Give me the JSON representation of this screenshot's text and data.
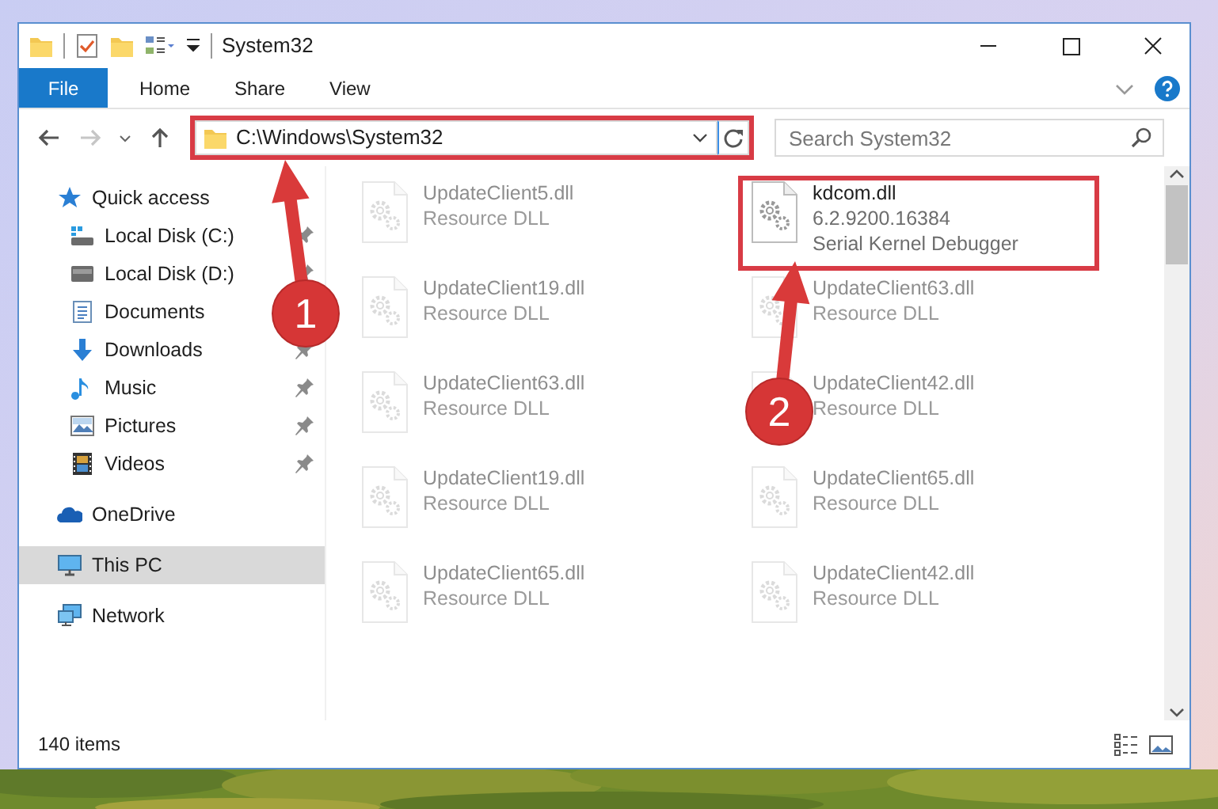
{
  "window": {
    "title": "System32"
  },
  "ribbon_tabs": [
    {
      "label": "File",
      "kind": "file"
    },
    {
      "label": "Home",
      "kind": "tab"
    },
    {
      "label": "Share",
      "kind": "tab"
    },
    {
      "label": "View",
      "kind": "tab"
    }
  ],
  "address": {
    "path": "C:\\Windows\\System32",
    "highlighted": true
  },
  "search": {
    "placeholder": "Search System32"
  },
  "navigation": {
    "forward_disabled": true
  },
  "sidebar": {
    "items": [
      {
        "label": "Quick access",
        "kind": "quick-access",
        "selected": false,
        "children": [
          {
            "label": "Local Disk (C:)",
            "kind": "drive-c",
            "pinned": true
          },
          {
            "label": "Local Disk (D:)",
            "kind": "drive",
            "pinned": true
          },
          {
            "label": "Documents",
            "kind": "documents",
            "pinned": false
          },
          {
            "label": "Downloads",
            "kind": "downloads",
            "pinned": true
          },
          {
            "label": "Music",
            "kind": "music",
            "pinned": true
          },
          {
            "label": "Pictures",
            "kind": "pictures",
            "pinned": true
          },
          {
            "label": "Videos",
            "kind": "videos",
            "pinned": true
          }
        ]
      },
      {
        "label": "OneDrive",
        "kind": "onedrive",
        "selected": false
      },
      {
        "label": "This PC",
        "kind": "this-pc",
        "selected": true
      },
      {
        "label": "Network",
        "kind": "network",
        "selected": false
      }
    ]
  },
  "files": [
    {
      "name": "UpdateClient5.dll",
      "details": [
        "Resource DLL"
      ],
      "faded": true,
      "highlighted": false
    },
    {
      "name": "kdcom.dll",
      "details": [
        "6.2.9200.16384",
        "Serial Kernel Debugger"
      ],
      "faded": false,
      "highlighted": true
    },
    {
      "name": "UpdateClient19.dll",
      "details": [
        "Resource DLL"
      ],
      "faded": true,
      "highlighted": false
    },
    {
      "name": "UpdateClient63.dll",
      "details": [
        "Resource DLL"
      ],
      "faded": true,
      "highlighted": false
    },
    {
      "name": "UpdateClient63.dll",
      "details": [
        "Resource DLL"
      ],
      "faded": true,
      "highlighted": false
    },
    {
      "name": "UpdateClient42.dll",
      "details": [
        "Resource DLL"
      ],
      "faded": true,
      "highlighted": false
    },
    {
      "name": "UpdateClient19.dll",
      "details": [
        "Resource DLL"
      ],
      "faded": true,
      "highlighted": false
    },
    {
      "name": "UpdateClient65.dll",
      "details": [
        "Resource DLL"
      ],
      "faded": true,
      "highlighted": false
    },
    {
      "name": "UpdateClient65.dll",
      "details": [
        "Resource DLL"
      ],
      "faded": true,
      "highlighted": false
    },
    {
      "name": "UpdateClient42.dll",
      "details": [
        "Resource DLL"
      ],
      "faded": true,
      "highlighted": false
    }
  ],
  "status_bar": {
    "item_count": "140 items"
  },
  "annotations": [
    {
      "number": "1"
    },
    {
      "number": "2"
    }
  ]
}
